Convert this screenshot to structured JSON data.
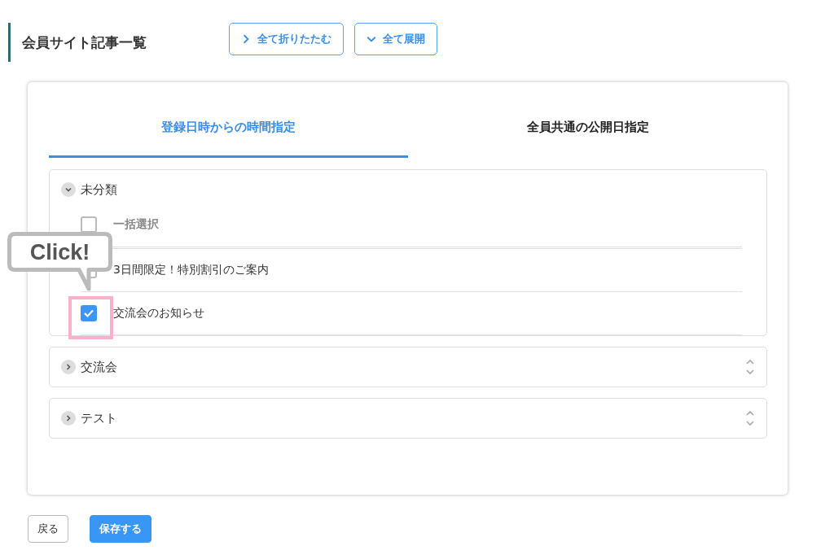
{
  "header": {
    "title": "会員サイト記事一覧",
    "buttons": [
      {
        "label": "全て折りたたむ",
        "kind": "collapse"
      },
      {
        "label": "全て展開",
        "kind": "expand"
      }
    ]
  },
  "tabs": [
    {
      "label": "登録日時からの時間指定",
      "selected": true
    },
    {
      "label": "全員共通の公開日指定",
      "selected": false
    }
  ],
  "groups": [
    {
      "name": "未分類",
      "expanded": true,
      "items": [
        {
          "kind": "select_all",
          "label": "一括選択",
          "checked": false
        },
        {
          "kind": "article",
          "label": "3日間限定！特別割引のご案内",
          "checked": false
        },
        {
          "kind": "article",
          "label": "交流会のお知らせ",
          "checked": true
        }
      ]
    },
    {
      "name": "交流会",
      "expanded": false
    },
    {
      "name": "テスト",
      "expanded": false
    }
  ],
  "callout": {
    "text": "Click!"
  },
  "footer": {
    "buttons": [
      {
        "label": "戻る",
        "kind": "secondary"
      },
      {
        "label": "保存する",
        "kind": "primary"
      }
    ]
  }
}
